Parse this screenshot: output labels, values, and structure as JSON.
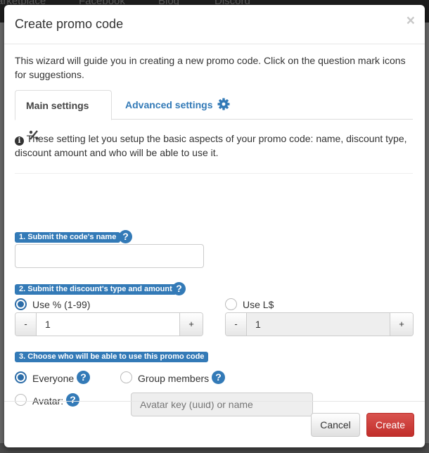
{
  "background_nav": {
    "items": [
      "arketplace",
      "Facebook",
      "Blog",
      "Discord"
    ]
  },
  "modal": {
    "title": "Create promo code",
    "close_glyph": "×",
    "intro": "This wizard will guide you in creating a new promo code. Click on the question mark icons for suggestions.",
    "tabs": [
      {
        "label": "Main settings",
        "icon": "percent-icon",
        "active": true
      },
      {
        "label": "Advanced settings",
        "icon": "gear-icon",
        "active": false
      }
    ],
    "info_text": "These setting let you setup the basic aspects of your promo code: name, discount type, discount amount and who will be able to use it.",
    "section1": {
      "label": "1. Submit the code's name",
      "name_value": "",
      "help_glyph": "?"
    },
    "section2": {
      "label": "2. Submit the discount's type and amount",
      "help_glyph": "?",
      "percent_option": {
        "label": "Use % (1-99)",
        "checked": true,
        "value": "1",
        "minus": "-",
        "plus": "+"
      },
      "ls_option": {
        "label": "Use L$",
        "checked": false,
        "value": "1",
        "minus": "-",
        "plus": "+"
      }
    },
    "section3": {
      "label": "3. Choose who will be able to use this promo code",
      "options": [
        {
          "label": "Everyone",
          "checked": true
        },
        {
          "label": "Group members",
          "checked": false
        },
        {
          "label": "Avatar:",
          "checked": false
        }
      ],
      "avatar_placeholder": "Avatar key (uuid) or name",
      "help_glyph": "?"
    },
    "footer": {
      "cancel_label": "Cancel",
      "create_label": "Create"
    },
    "colors": {
      "primary": "#337ab7",
      "danger": "#d9534f"
    }
  }
}
